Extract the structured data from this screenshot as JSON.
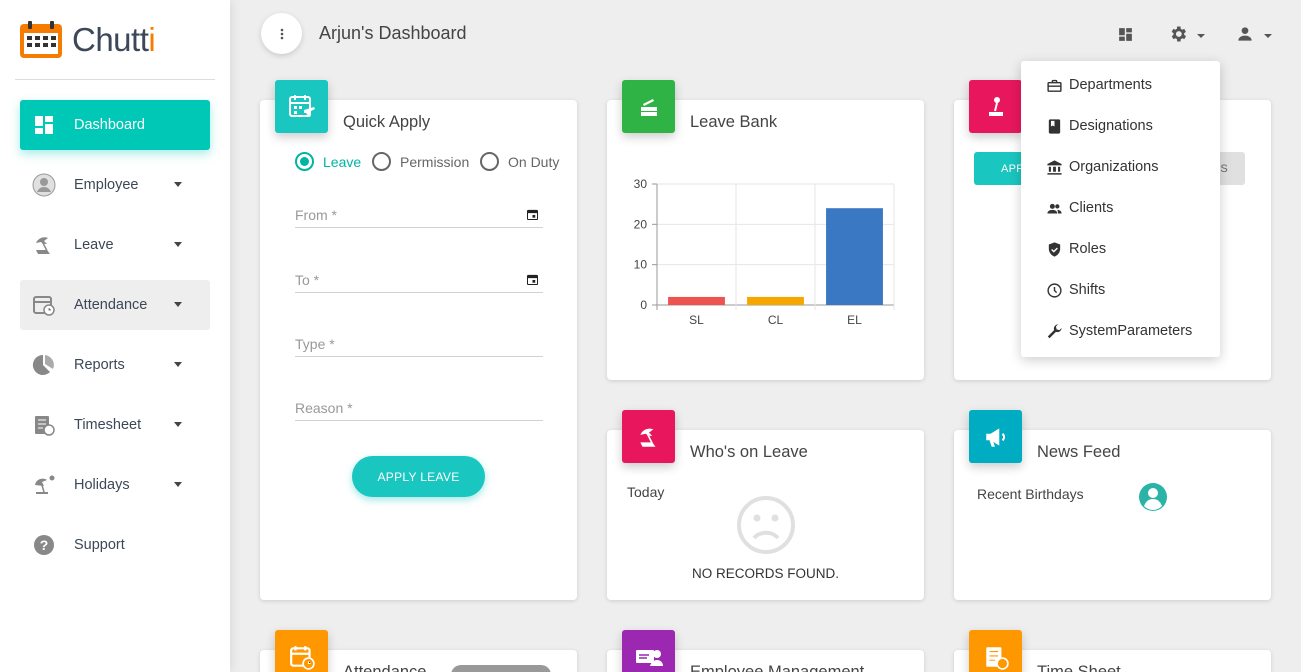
{
  "brand": {
    "name_main": "Chutt",
    "name_accent": "i"
  },
  "sidebar": {
    "items": [
      {
        "label": "Dashboard",
        "icon": "dashboard-icon",
        "active": true
      },
      {
        "label": "Employee",
        "icon": "person-icon",
        "caret": true
      },
      {
        "label": "Leave",
        "icon": "beach-icon",
        "caret": true
      },
      {
        "label": "Attendance",
        "icon": "calendar-clock-icon",
        "caret": true
      },
      {
        "label": "Reports",
        "icon": "pie-chart-icon",
        "caret": true
      },
      {
        "label": "Timesheet",
        "icon": "timesheet-icon",
        "caret": true
      },
      {
        "label": "Holidays",
        "icon": "holiday-icon",
        "caret": true
      },
      {
        "label": "Support",
        "icon": "help-icon"
      }
    ]
  },
  "header": {
    "title": "Arjun's Dashboard"
  },
  "quick_apply": {
    "title": "Quick Apply",
    "radios": [
      "Leave",
      "Permission",
      "On Duty"
    ],
    "selected": "Leave",
    "fields": {
      "from": "From *",
      "to": "To *",
      "type": "Type *",
      "reason": "Reason *"
    },
    "submit": "APPLY LEAVE"
  },
  "leave_bank": {
    "title": "Leave Bank"
  },
  "chart_data": {
    "type": "bar",
    "categories": [
      "SL",
      "CL",
      "EL"
    ],
    "values": [
      2,
      2,
      24
    ],
    "colors": [
      "#ef5350",
      "#f5a700",
      "#3a78c3"
    ],
    "ylim": [
      0,
      30
    ],
    "yticks": [
      0,
      10,
      20,
      30
    ],
    "grid": true
  },
  "third_card": {
    "button_partial": "APP",
    "button2_partial": "S"
  },
  "whos_on_leave": {
    "title": "Who's on Leave",
    "subtitle": "Today",
    "empty": "NO RECORDS FOUND."
  },
  "news_feed": {
    "title": "News Feed",
    "subtitle": "Recent Birthdays"
  },
  "bottom_cards": [
    {
      "title": "Attendance"
    },
    {
      "title": "Employee Management"
    },
    {
      "title": "Time Sheet"
    }
  ],
  "settings_menu": {
    "items": [
      {
        "label": "Departments",
        "icon": "briefcase-icon"
      },
      {
        "label": "Designations",
        "icon": "book-icon"
      },
      {
        "label": "Organizations",
        "icon": "bank-icon"
      },
      {
        "label": "Clients",
        "icon": "people-icon"
      },
      {
        "label": "Roles",
        "icon": "shield-icon"
      },
      {
        "label": "Shifts",
        "icon": "clock-icon"
      },
      {
        "label": "SystemParameters",
        "icon": "wrench-icon"
      }
    ]
  },
  "colors": {
    "accent": "#00c8b6",
    "teal": "#00bfae",
    "green": "#2fb344",
    "pink": "#e8175d",
    "cyan": "#00acc1",
    "orange": "#ff9800",
    "purple": "#9c27b0"
  }
}
